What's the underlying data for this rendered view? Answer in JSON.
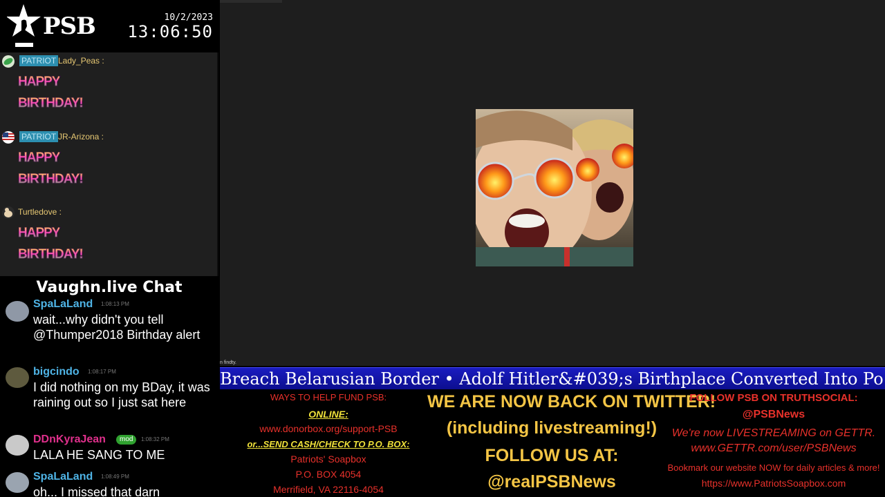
{
  "brand": {
    "logo_text": "PSB"
  },
  "clock": {
    "date": "10/2/2023",
    "time": "13:06:50"
  },
  "chat_top": {
    "messages": [
      {
        "badge": "PATRIOT",
        "name": "Lady_Peas :",
        "line1": "HAPPY",
        "line2": "BIRTHDAY!"
      },
      {
        "badge": "PATRIOT",
        "name": "JR-Arizona :",
        "line1": "HAPPY",
        "line2": "BIRTHDAY!"
      },
      {
        "badge": "",
        "name": "Turtledove :",
        "line1": "HAPPY",
        "line2": "BIRTHDAY!"
      }
    ]
  },
  "vaughn": {
    "title": "Vaughn.live Chat",
    "messages": [
      {
        "name": "SpaLaLand",
        "name_color": "#4fb4e6",
        "time": "1:08:13 PM",
        "mod": "",
        "text": "wait...why didn't you tell @Thumper2018 Birthday alert"
      },
      {
        "name": "bigcindo",
        "name_color": "#4fb4e6",
        "time": "1:08:17 PM",
        "mod": "",
        "text": "I did nothing on my BDay, it was raining out so I just sat here"
      },
      {
        "name": "DDnKyraJean",
        "name_color": "#e0308c",
        "time": "1:08:32 PM",
        "mod": "mod",
        "text": "LALA HE SANG TO ME"
      },
      {
        "name": "SpaLaLand",
        "name_color": "#4fb4e6",
        "time": "1:08:49 PM",
        "mod": "",
        "text": "oh... I missed that darn"
      }
    ]
  },
  "stage": {
    "caption": "n findty."
  },
  "ticker": {
    "text": "Breach Belarusian Border  •  Adolf Hitler&#039;s Birthplace Converted Into Po"
  },
  "info": {
    "left": {
      "heading": "WAYS TO HELP FUND PSB:",
      "online_label": "ONLINE:",
      "online_url": "www.donorbox.org/support-PSB",
      "mail_label": "or...SEND CASH/CHECK TO P.O. BOX:",
      "addr1": "Patriots' Soapbox",
      "addr2": "P.O. BOX 4054",
      "addr3": "Merrifield, VA 22116-4054"
    },
    "middle": {
      "line1": "WE ARE NOW BACK ON TWITTER!",
      "line2": "(including livestreaming!)",
      "line3": "FOLLOW US AT:",
      "line4": "@realPSBNews"
    },
    "right": {
      "heading": "FOLLOW PSB ON TRUTHSOCIAL:",
      "handle": "@PSBNews",
      "gettr1": "We're now LIVESTREAMING on GETTR.",
      "gettr2": "www.GETTR.com/user/PSBNews",
      "bookmark": "Bookmark our website NOW for daily articles & more!",
      "site": "https://www.PatriotsSoapbox.com"
    }
  }
}
